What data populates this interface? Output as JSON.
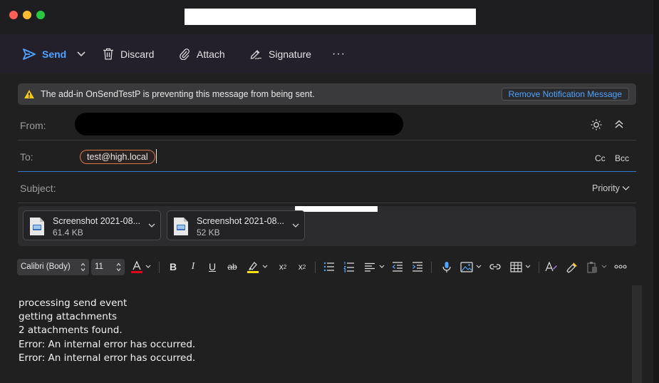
{
  "toolbar": {
    "send": "Send",
    "discard": "Discard",
    "attach": "Attach",
    "signature": "Signature",
    "more": "···"
  },
  "banner": {
    "message": "The add-in OnSendTestP is preventing this message from being sent.",
    "button": "Remove Notification Message"
  },
  "header": {
    "from_label": "From:",
    "to_label": "To:",
    "subject_label": "Subject:",
    "recipient": "test@high.local",
    "cc": "Cc",
    "bcc": "Bcc",
    "priority": "Priority"
  },
  "attachments": [
    {
      "name": "Screenshot 2021-08...",
      "size": "61.4 KB"
    },
    {
      "name": "Screenshot 2021-08...",
      "size": "52 KB"
    }
  ],
  "format": {
    "font": "Calibri (Body)",
    "size": "11",
    "font_color": "#e0001b",
    "highlight_color": "#ffe100"
  },
  "body": {
    "lines": [
      "processing send event",
      "getting attachments",
      "2 attachments found.",
      "Error: An internal error has occurred.",
      "Error: An internal error has occurred."
    ]
  },
  "colors": {
    "accent": "#4da3ff",
    "warning": "#f5c518"
  }
}
